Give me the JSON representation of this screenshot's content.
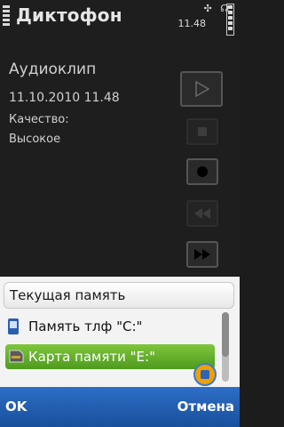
{
  "app": {
    "title": "Диктофон"
  },
  "status": {
    "time": "11.48"
  },
  "clip": {
    "name": "Аудиоклип",
    "datetime": "11.10.2010 11.48",
    "quality_label": "Качество:",
    "quality_value": "Высокое"
  },
  "controls": [
    {
      "name": "play",
      "enabled": true
    },
    {
      "name": "stop",
      "enabled": false
    },
    {
      "name": "record",
      "enabled": true
    },
    {
      "name": "rewind",
      "enabled": false
    },
    {
      "name": "fast-forward",
      "enabled": true
    }
  ],
  "memory_menu": {
    "title": "Текущая память",
    "options": [
      {
        "label": "Память тлф \"C:\"",
        "icon": "phone-icon",
        "selected": false
      },
      {
        "label": "Карта памяти \"E:\"",
        "icon": "memory-card-icon",
        "selected": true
      }
    ]
  },
  "softkeys": {
    "left": "OK",
    "right": "Отмена"
  },
  "colors": {
    "accent": "#4e9a1f",
    "softbar": "#1a4f9c"
  }
}
